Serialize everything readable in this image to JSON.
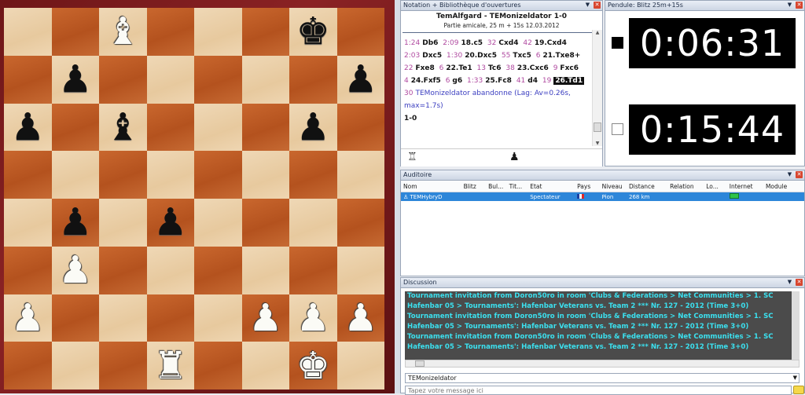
{
  "board": {
    "rows": [
      [
        {
          "c": "",
          "color": ""
        },
        {
          "c": "",
          "color": ""
        },
        {
          "c": "♝",
          "color": "white"
        },
        {
          "c": "",
          "color": ""
        },
        {
          "c": "",
          "color": ""
        },
        {
          "c": "",
          "color": ""
        },
        {
          "c": "♚",
          "color": "black"
        },
        {
          "c": "",
          "color": ""
        }
      ],
      [
        {
          "c": "",
          "color": ""
        },
        {
          "c": "♟",
          "color": "black"
        },
        {
          "c": "",
          "color": ""
        },
        {
          "c": "",
          "color": ""
        },
        {
          "c": "",
          "color": ""
        },
        {
          "c": "",
          "color": ""
        },
        {
          "c": "",
          "color": ""
        },
        {
          "c": "♟",
          "color": "black"
        }
      ],
      [
        {
          "c": "♟",
          "color": "black"
        },
        {
          "c": "",
          "color": ""
        },
        {
          "c": "♝",
          "color": "black"
        },
        {
          "c": "",
          "color": ""
        },
        {
          "c": "",
          "color": ""
        },
        {
          "c": "",
          "color": ""
        },
        {
          "c": "♟",
          "color": "black"
        },
        {
          "c": "",
          "color": ""
        }
      ],
      [
        {
          "c": "",
          "color": ""
        },
        {
          "c": "",
          "color": ""
        },
        {
          "c": "",
          "color": ""
        },
        {
          "c": "",
          "color": ""
        },
        {
          "c": "",
          "color": ""
        },
        {
          "c": "",
          "color": ""
        },
        {
          "c": "",
          "color": ""
        },
        {
          "c": "",
          "color": ""
        }
      ],
      [
        {
          "c": "",
          "color": ""
        },
        {
          "c": "♟",
          "color": "black"
        },
        {
          "c": "",
          "color": ""
        },
        {
          "c": "♟",
          "color": "black"
        },
        {
          "c": "",
          "color": ""
        },
        {
          "c": "",
          "color": ""
        },
        {
          "c": "",
          "color": ""
        },
        {
          "c": "",
          "color": ""
        }
      ],
      [
        {
          "c": "",
          "color": ""
        },
        {
          "c": "♟",
          "color": "white"
        },
        {
          "c": "",
          "color": ""
        },
        {
          "c": "",
          "color": ""
        },
        {
          "c": "",
          "color": ""
        },
        {
          "c": "",
          "color": ""
        },
        {
          "c": "",
          "color": ""
        },
        {
          "c": "",
          "color": ""
        }
      ],
      [
        {
          "c": "♟",
          "color": "white"
        },
        {
          "c": "",
          "color": ""
        },
        {
          "c": "",
          "color": ""
        },
        {
          "c": "",
          "color": ""
        },
        {
          "c": "",
          "color": ""
        },
        {
          "c": "♟",
          "color": "white"
        },
        {
          "c": "♟",
          "color": "white"
        },
        {
          "c": "♟",
          "color": "white"
        }
      ],
      [
        {
          "c": "",
          "color": ""
        },
        {
          "c": "",
          "color": ""
        },
        {
          "c": "",
          "color": ""
        },
        {
          "c": "♜",
          "color": "white"
        },
        {
          "c": "",
          "color": ""
        },
        {
          "c": "",
          "color": ""
        },
        {
          "c": "♚",
          "color": "white"
        },
        {
          "c": "",
          "color": ""
        }
      ]
    ]
  },
  "notation": {
    "panel_title": "Notation + Bibliothèque d'ouvertures",
    "game_title": "TemAlfgard - TEMonizeldator  1-0",
    "game_sub": "Partie amicale, 25 m + 15s 12.03.2012",
    "tokens": [
      {
        "t": "1:24",
        "m": "Db6"
      },
      {
        "t": "2:09",
        "m": "18.c5"
      },
      {
        "t": "32",
        "m": "Cxd4"
      },
      {
        "t": "42",
        "m": "19.Cxd4"
      },
      {
        "t": "2:03",
        "m": "Dxc5"
      },
      {
        "t": "1:30",
        "m": "20.Dxc5"
      },
      {
        "t": "55",
        "m": "Txc5"
      },
      {
        "t": "6",
        "m": "21.Txe8+"
      },
      {
        "t": "22",
        "m": "Fxe8"
      },
      {
        "t": "6",
        "m": "22.Te1"
      },
      {
        "t": "13",
        "m": "Tc6"
      },
      {
        "t": "38",
        "m": "23.Cxc6"
      },
      {
        "t": "9",
        "m": "Fxc6"
      },
      {
        "t": "4",
        "m": "24.Fxf5"
      },
      {
        "t": "6",
        "m": "g6"
      },
      {
        "t": "1:33",
        "m": "25.Fc8"
      },
      {
        "t": "41",
        "m": "d4"
      },
      {
        "t": "19",
        "m": "26.Td1"
      }
    ],
    "last_time": "30",
    "abandon_text": "TEMonizeldator abandonne  (Lag: Av=0.26s, max=1.7s)",
    "result": "1-0",
    "white_icon": "♖",
    "black_icon": "♟"
  },
  "clock": {
    "panel_title": "Pendule: Blitz 25m+15s",
    "white_time": "0:06:31",
    "black_time": "0:15:44"
  },
  "audience": {
    "panel_title": "Auditoire",
    "columns": [
      "Nom",
      "Blitz",
      "Bul...",
      "Tit...",
      "Etat",
      "Pays",
      "Niveau",
      "Distance",
      "Relation",
      "Lo...",
      "Internet",
      "Module"
    ],
    "row": {
      "name": "TEMHybryD",
      "etat": "Spectateur",
      "niveau": "Pion",
      "distance": "268 km"
    }
  },
  "discussion": {
    "panel_title": "Discussion",
    "lines": [
      "Tournament invitation from Doron50ro in room 'Clubs & Federations > Net Communities > 1. SC",
      "Hafenbar 05 > Tournaments': Hafenbar Veterans vs. Team 2 *** Nr. 127 - 2012 (Time 3+0)",
      "Tournament invitation from Doron50ro in room 'Clubs & Federations > Net Communities > 1. SC",
      "Hafenbar 05 > Tournaments': Hafenbar Veterans vs. Team 2 *** Nr. 127 - 2012 (Time 3+0)",
      "Tournament invitation from Doron50ro in room 'Clubs & Federations > Net Communities > 1. SC",
      "Hafenbar 05 > Tournaments': Hafenbar Veterans vs. Team 2 *** Nr. 127 - 2012 (Time 3+0)"
    ],
    "target": "TEMonizeldator",
    "placeholder": "Tapez votre message ici"
  }
}
